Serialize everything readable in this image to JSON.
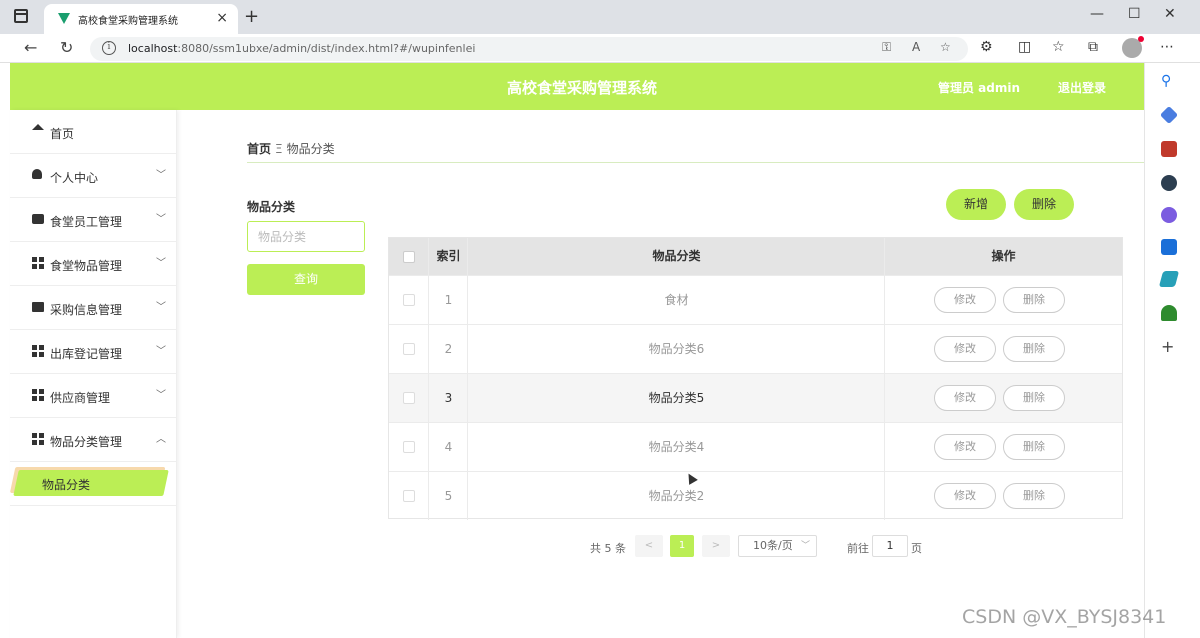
{
  "browser": {
    "tab_title": "高校食堂采购管理系统",
    "url_host": "localhost",
    "url_rest": ":8080/ssm1ubxe/admin/dist/index.html?#/wupinfenlei"
  },
  "header": {
    "title": "高校食堂采购管理系统",
    "admin_label": "管理员 admin",
    "logout_label": "退出登录"
  },
  "sidebar": {
    "items": [
      {
        "label": "首页"
      },
      {
        "label": "个人中心"
      },
      {
        "label": "食堂员工管理"
      },
      {
        "label": "食堂物品管理"
      },
      {
        "label": "采购信息管理"
      },
      {
        "label": "出库登记管理"
      },
      {
        "label": "供应商管理"
      },
      {
        "label": "物品分类管理"
      }
    ],
    "active_sub_label": "物品分类"
  },
  "breadcrumb": {
    "home": "首页",
    "separator": "Ξ",
    "current": "物品分类"
  },
  "filter": {
    "label": "物品分类",
    "placeholder": "物品分类",
    "query_label": "查询"
  },
  "actions": {
    "add_label": "新增",
    "delete_label": "删除"
  },
  "table": {
    "headers": {
      "index": "索引",
      "category": "物品分类",
      "actions": "操作"
    },
    "rows": [
      {
        "index": "1",
        "category": "食材",
        "edit": "修改",
        "delete": "删除"
      },
      {
        "index": "2",
        "category": "物品分类6",
        "edit": "修改",
        "delete": "删除"
      },
      {
        "index": "3",
        "category": "物品分类5",
        "edit": "修改",
        "delete": "删除"
      },
      {
        "index": "4",
        "category": "物品分类4",
        "edit": "修改",
        "delete": "删除"
      },
      {
        "index": "5",
        "category": "物品分类2",
        "edit": "修改",
        "delete": "删除"
      }
    ]
  },
  "pagination": {
    "total": "共 5 条",
    "prev": "<",
    "current_page": "1",
    "next": ">",
    "page_size": "10条/页",
    "goto_label": "前往",
    "goto_value": "1",
    "page_unit": "页"
  },
  "watermark": "CSDN @VX_BYSJ8341",
  "colors": {
    "accent": "#bbee55"
  }
}
